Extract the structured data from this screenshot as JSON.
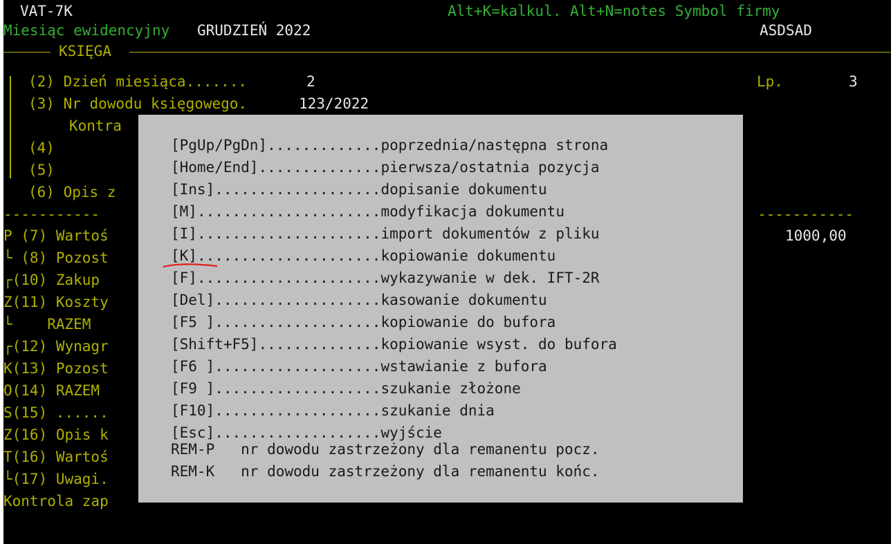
{
  "header": {
    "form_code": "VAT-7K",
    "shortcuts": "Alt+K=kalkul. Alt+N=notes Symbol firmy",
    "month_label": "Miesiąc ewidencyjny",
    "month_value": "GRUDZIEŃ 2022",
    "company_symbol": "ASDSAD"
  },
  "section_title": "KSIĘGA",
  "fields": {
    "day_label": "(2) Dzień miesiąca.......",
    "day_value": "2",
    "lp_label": "Lp.",
    "lp_value": "3",
    "doc_label": "(3) Nr dowodu księgowego.",
    "doc_value": "123/2022",
    "kontra": "Kontra",
    "f4": "(4)",
    "f5": "(5)",
    "f6": "(6) Opis z",
    "dashes_left": "-----------",
    "dashes_right": "-----------",
    "f7": "P (7) Wartoś",
    "f7_value": "1000,00",
    "f8": "└ (8) Pozost",
    "f10": "┌(10) Zakup",
    "f11": "Z(11) Koszty",
    "razem1": "└    RAZEM",
    "f12": "┌(12) Wynagr",
    "f13": "K(13) Pozost",
    "f14": "O(14) RAZEM",
    "f15": "S(15) ......",
    "f16a": "Z(16) Opis k",
    "f16b": "T(16) Wartoś",
    "f17": "└(17) Uwagi.",
    "kontrola": "Kontrola zap"
  },
  "help_popup": {
    "rows": [
      {
        "key": "[PgUp/PgDn]",
        "dots": ".............",
        "action": "poprzednia/następna strona"
      },
      {
        "key": "[Home/End]",
        "dots": "..............",
        "action": "pierwsza/ostatnia pozycja"
      },
      {
        "key": "[Ins]",
        "dots": "...................",
        "action": "dopisanie dokumentu"
      },
      {
        "key": "[M]",
        "dots": ".....................",
        "action": "modyfikacja dokumentu"
      },
      {
        "key": "[I]",
        "dots": ".....................",
        "action": "import dokumentów z pliku"
      },
      {
        "key": "[K]",
        "dots": ".....................",
        "action": "kopiowanie dokumentu"
      },
      {
        "key": "[F]",
        "dots": ".....................",
        "action": "wykazywanie w dek. IFT-2R"
      },
      {
        "key": "[Del]",
        "dots": "...................",
        "action": "kasowanie dokumentu"
      },
      {
        "key": "[F5 ]",
        "dots": "...................",
        "action": "kopiowanie do bufora"
      },
      {
        "key": "[Shift+F5]",
        "dots": "..............",
        "action": "kopiowanie wsyst. do bufora"
      },
      {
        "key": "[F6 ]",
        "dots": "...................",
        "action": "wstawianie z bufora"
      },
      {
        "key": "[F9 ]",
        "dots": "...................",
        "action": "szukanie złożone"
      },
      {
        "key": "[F10]",
        "dots": "...................",
        "action": "szukanie dnia"
      },
      {
        "key": "[Esc]",
        "dots": "...................",
        "action": "wyjście"
      }
    ],
    "rem_p": "REM-P   nr dowodu zastrzeżony dla remanentu pocz.",
    "rem_k": "REM-K   nr dowodu zastrzeżony dla remanentu końc."
  },
  "colors": {
    "background": "#000000",
    "label_yellow": "#b0b000",
    "label_green": "#33b033",
    "value_white": "#e8e8e8",
    "popup_bg": "#c0c0c0",
    "annotation_red": "#e0201a"
  }
}
